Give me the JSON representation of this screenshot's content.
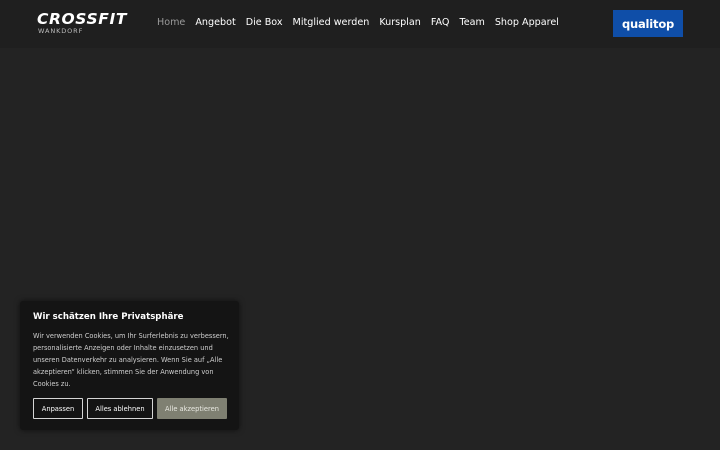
{
  "logo": {
    "main": "CROSSFIT",
    "sub": "WANKDORF"
  },
  "nav": [
    {
      "label": "Home",
      "active": true
    },
    {
      "label": "Angebot",
      "active": false
    },
    {
      "label": "Die Box",
      "active": false
    },
    {
      "label": "Mitglied werden",
      "active": false
    },
    {
      "label": "Kursplan",
      "active": false
    },
    {
      "label": "FAQ",
      "active": false
    },
    {
      "label": "Team",
      "active": false
    },
    {
      "label": "Shop Apparel",
      "active": false
    }
  ],
  "partner": {
    "label": "qualitop",
    "color": "#0f4ea8"
  },
  "cookie": {
    "title": "Wir schätzen Ihre Privatsphäre",
    "text": "Wir verwenden Cookies, um Ihr Surferlebnis zu verbessern, personalisierte Anzeigen oder Inhalte einzusetzen und unseren Datenverkehr zu analysieren. Wenn Sie auf „Alle akzeptieren“ klicken, stimmen Sie der Anwendung von Cookies zu.",
    "buttons": {
      "customize": "Anpassen",
      "reject": "Alles ablehnen",
      "accept": "Alle akzeptieren"
    }
  },
  "colors": {
    "background": "#232323",
    "banner": "#141414",
    "accept_button": "#7f8072",
    "nav_active": "#9a9a9a"
  }
}
